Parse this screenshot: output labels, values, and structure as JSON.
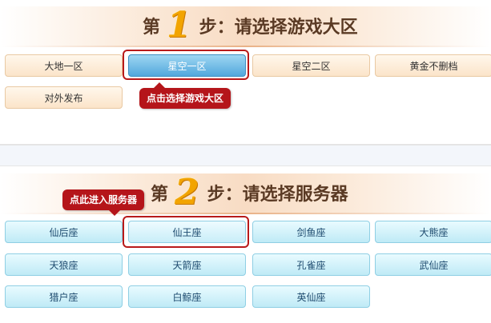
{
  "step1": {
    "prefix": "第",
    "number": "1",
    "suffix": "步：请选择游戏大区",
    "zones": [
      "大地一区",
      "星空一区",
      "星空二区",
      "黄金不删档",
      "对外发布"
    ],
    "selected_zone": "星空一区",
    "tooltip": "点击选择游戏大区"
  },
  "step2": {
    "prefix": "第",
    "number": "2",
    "suffix": "步：请选择服务器",
    "servers": [
      "仙后座",
      "仙王座",
      "剑鱼座",
      "大熊座",
      "天狼座",
      "天箭座",
      "孔雀座",
      "武仙座",
      "猎户座",
      "白鲸座",
      "英仙座"
    ],
    "selected_server": "仙王座",
    "tooltip": "点此进入服务器"
  },
  "colors": {
    "zone_button": "#fbe4c9",
    "zone_selected": "#52a8dc",
    "server_button": "#bfeaf6",
    "highlight_frame": "#b81a1a",
    "tooltip_bg": "#b5151a",
    "step_number": "#f2a400"
  }
}
